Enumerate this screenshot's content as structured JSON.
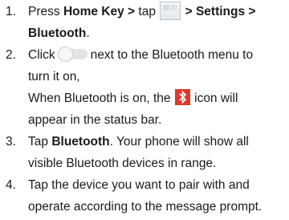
{
  "steps": [
    {
      "number": "1.",
      "line1_before": "Press ",
      "line1_bold": "Home Key >",
      "line1_mid": " tap ",
      "line1_icon": "apps-grid-icon",
      "line1_bold2": "> Settings >",
      "line2_bold": "Bluetooth",
      "line2_after": "."
    },
    {
      "number": "2.",
      "line1_before": "Click",
      "line1_icon": "toggle-off-icon",
      "line1_after": "next to the Bluetooth menu to",
      "line2": "turn it on,",
      "line3_before": "When Bluetooth is on, the ",
      "line3_icon": "bluetooth-icon",
      "line3_after": " icon will",
      "line4": "appear in the status bar."
    },
    {
      "number": "3.",
      "line1_before": "Tap ",
      "line1_bold": "Bluetooth",
      "line1_after": ". Your phone will show all",
      "line2": "visible Bluetooth devices in range."
    },
    {
      "number": "4.",
      "line1": "Tap the device you want to pair with and",
      "line2": "operate according to the message prompt."
    }
  ],
  "colors": {
    "bluetooth_icon_bg": "#e0392b",
    "text": "#1a1a1a"
  }
}
